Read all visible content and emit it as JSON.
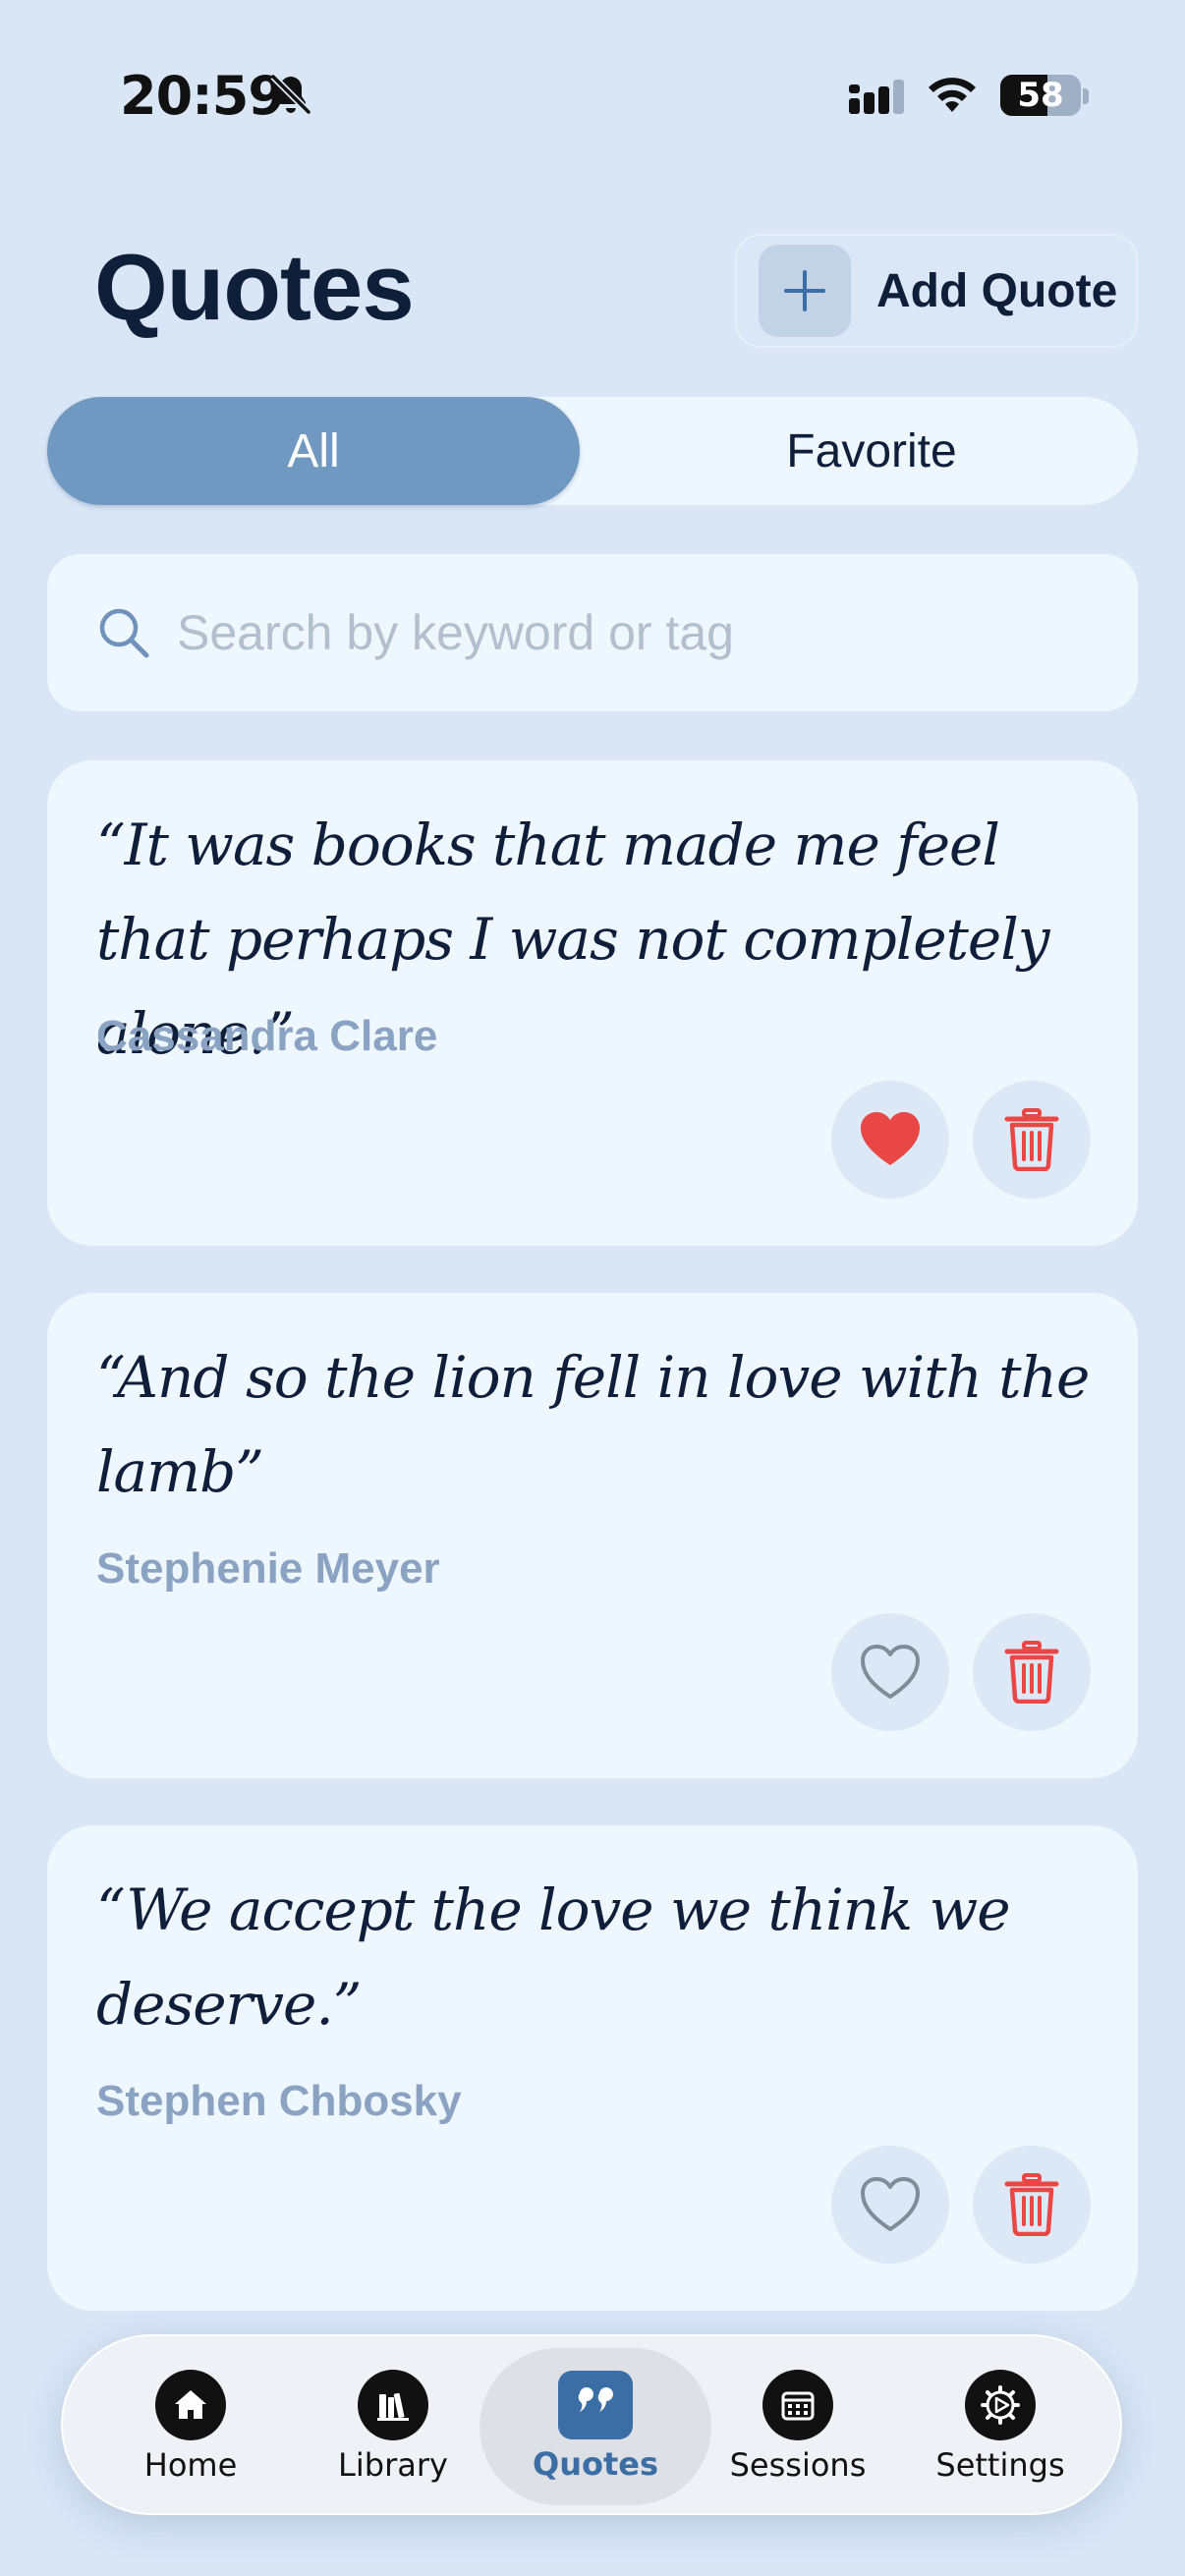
{
  "status_bar": {
    "time": "20:59",
    "battery": "58",
    "battery_level": 0.58
  },
  "header": {
    "title": "Quotes",
    "add_button_label": "Add Quote"
  },
  "segments": {
    "all_label": "All",
    "favorite_label": "Favorite",
    "selected": "All"
  },
  "search": {
    "placeholder": "Search by keyword or tag",
    "value": ""
  },
  "quotes": [
    {
      "text": "“It was books that made me feel that perhaps I was not completely alone.”",
      "author": "Cassandra Clare",
      "favorite": true
    },
    {
      "text": "“And so the lion fell in love with the lamb”",
      "author": "Stephenie Meyer",
      "favorite": false
    },
    {
      "text": "“We accept the love we think we deserve.”",
      "author": "Stephen Chbosky",
      "favorite": false
    }
  ],
  "tab_bar": {
    "items": [
      {
        "label": "Home",
        "icon": "home-icon"
      },
      {
        "label": "Library",
        "icon": "library-icon"
      },
      {
        "label": "Quotes",
        "icon": "quotes-icon"
      },
      {
        "label": "Sessions",
        "icon": "sessions-icon"
      },
      {
        "label": "Settings",
        "icon": "settings-icon"
      }
    ],
    "active": "Quotes"
  },
  "colors": {
    "background": "#d9e6f6",
    "card": "#eef6fe",
    "accent": "#7099c1",
    "tab_active": "#3b6ea5",
    "favorite_red": "#e94646",
    "author": "#8aa3c2"
  }
}
